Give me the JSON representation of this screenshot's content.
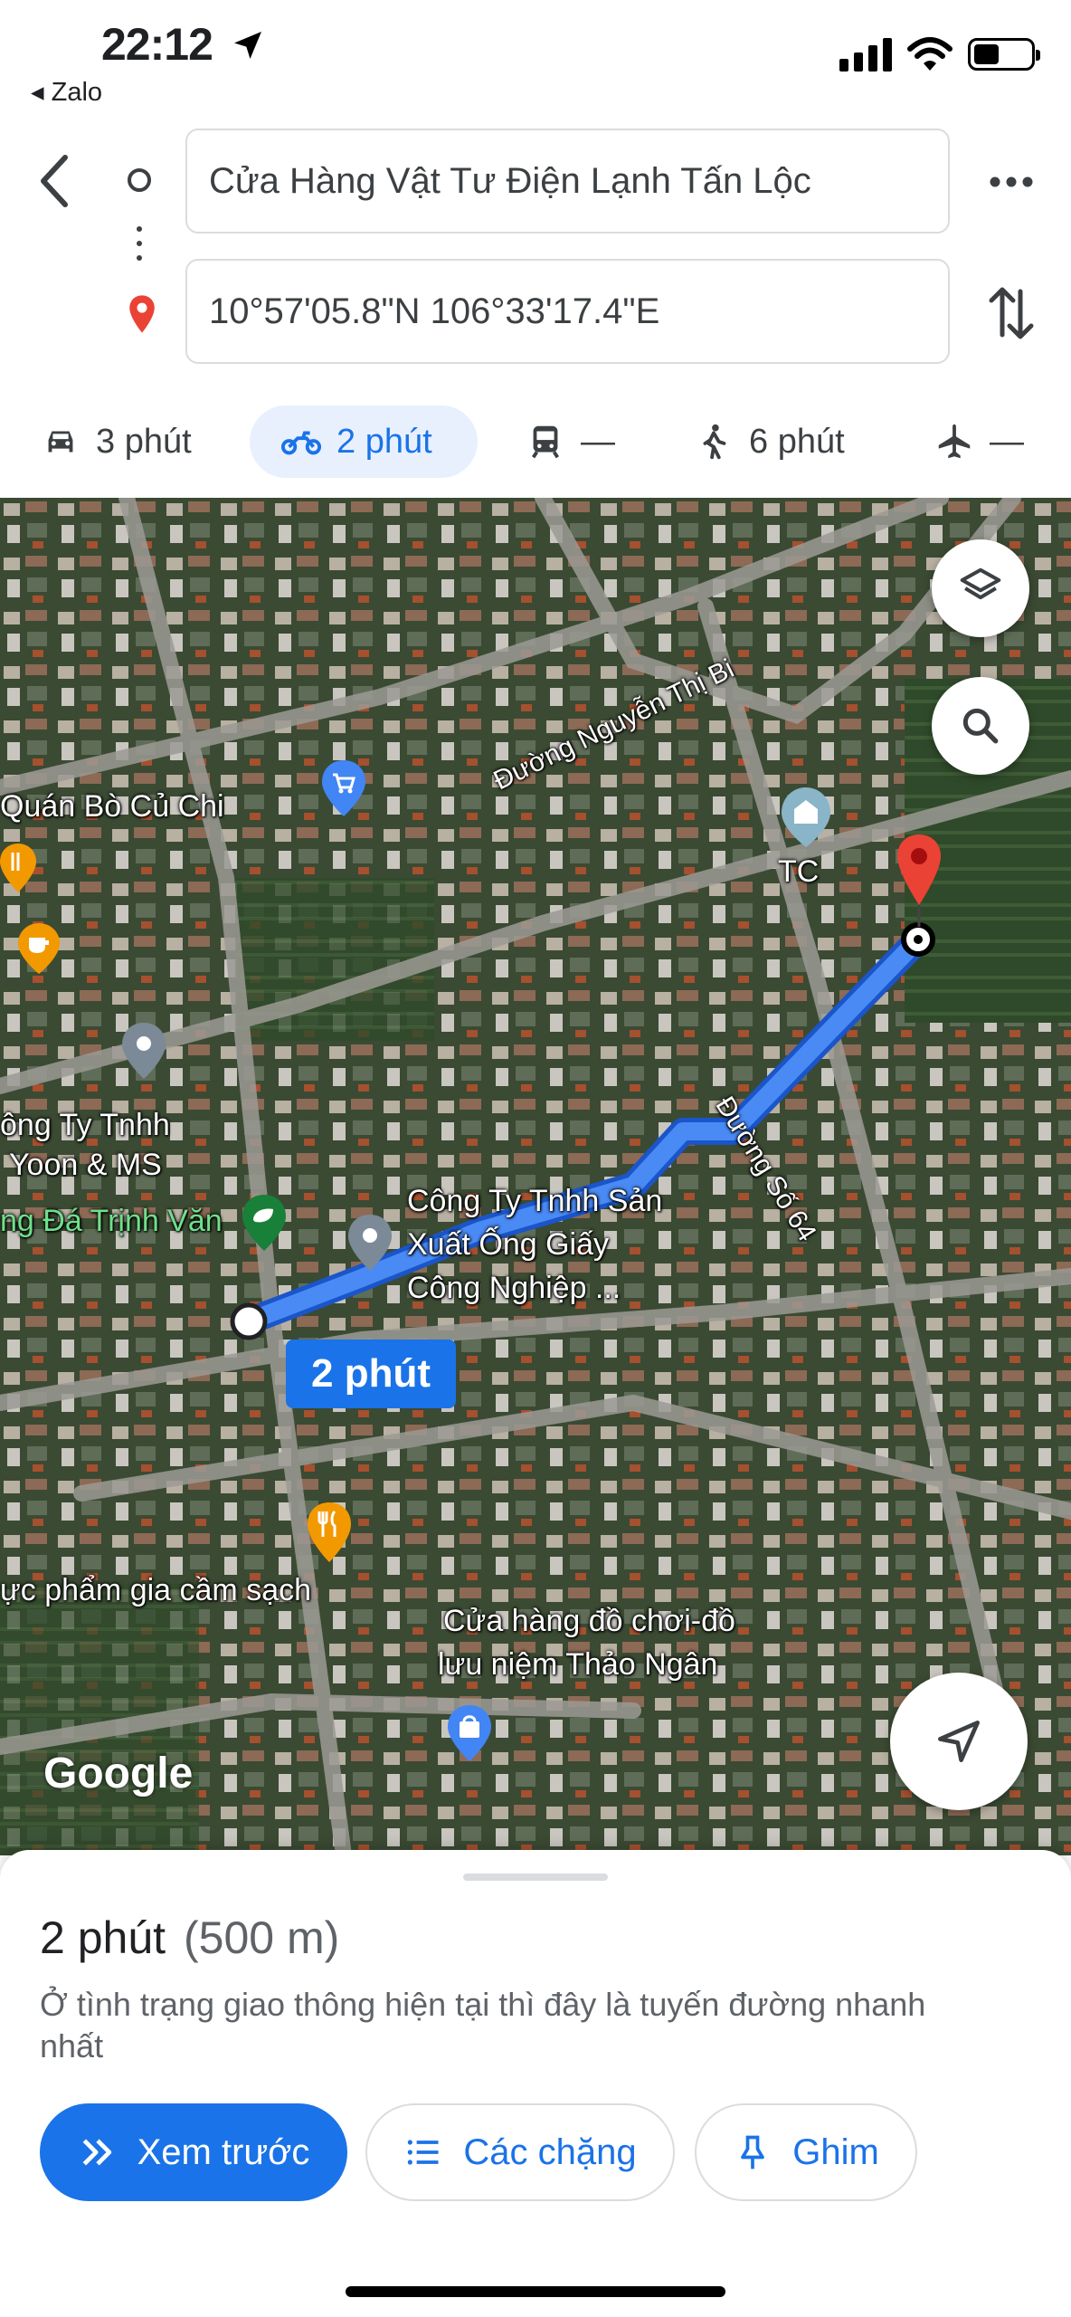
{
  "status_bar": {
    "time": "22:12",
    "back_app": "◂ Zalo"
  },
  "route": {
    "origin": "Cửa Hàng Vật Tư Điện Lạnh Tấn Lộc",
    "destination": "10°57'05.8\"N 106°33'17.4\"E"
  },
  "modes": [
    {
      "name": "car",
      "label": "3 phút"
    },
    {
      "name": "motorbike",
      "label": "2 phút",
      "active": true
    },
    {
      "name": "transit",
      "label": "—"
    },
    {
      "name": "walk",
      "label": "6 phút"
    },
    {
      "name": "flight",
      "label": "—"
    }
  ],
  "map": {
    "labels": {
      "quan_bo": "Quán Bò Củ Chi",
      "nguyen_thi_bi": "Đường Nguyễn Thị Bi",
      "tc": "TC",
      "cong_ty_yoon_1": "ông Ty Tnhh",
      "cong_ty_yoon_2": "Yoon & MS",
      "dang_trinh_van": "ng Đá Trịnh Văn",
      "ong_giay_1": "Công Ty Tnhh Sản",
      "ong_giay_2": "Xuất Ống Giấy",
      "ong_giay_3": "Công Nghiệp ...",
      "duong_so_64": "Đường Số 64",
      "thuc_pham": "ực phẩm gia cầm sạch",
      "do_choi_1": "Cửa hàng đồ chơi-đồ",
      "do_choi_2": "lưu niệm Thảo Ngân",
      "google": "Google"
    },
    "eta_bubble": "2 phút"
  },
  "sheet": {
    "duration": "2 phút",
    "distance": "(500 m)",
    "note": "Ở tình trạng giao thông hiện tại thì đây là tuyến đường nhanh nhất",
    "buttons": {
      "preview": "Xem trước",
      "steps": "Các chặng",
      "pin": "Ghim"
    }
  },
  "colors": {
    "accent": "#1a73e8",
    "route": "#4a8af4",
    "pin": "#ea4335"
  }
}
